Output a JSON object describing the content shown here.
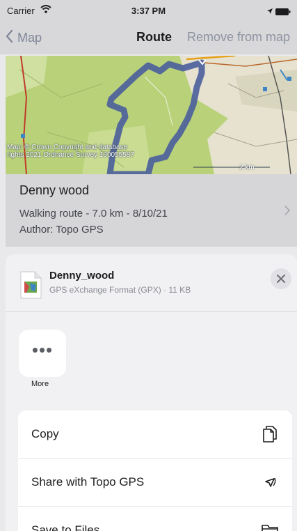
{
  "status_bar": {
    "carrier": "Carrier",
    "time": "3:37 PM"
  },
  "nav": {
    "back_label": "Map",
    "title": "Route",
    "action_label": "Remove from map"
  },
  "map": {
    "attribution": "Map: © Crown Copyright and database rights 2021 Ordnance Survey 100055587",
    "scale_label": "2 km"
  },
  "route": {
    "name": "Denny wood",
    "details": "Walking route - 7.0 km - 8/10/21",
    "author": "Author: Topo GPS"
  },
  "share_sheet": {
    "file_name": "Denny_wood",
    "file_meta": "GPS eXchange Format (GPX) · 11 KB",
    "more_label": "More",
    "actions": [
      {
        "label": "Copy",
        "icon": "copy-icon"
      },
      {
        "label": "Share with Topo GPS",
        "icon": "topo-gps-icon"
      },
      {
        "label": "Save to Files",
        "icon": "folder-icon"
      }
    ]
  },
  "colors": {
    "route_line": "#4a5e9c",
    "map_green": "#b9d27a",
    "sheet_bg": "#f1f1f4",
    "dim_bg": "#d8d8db"
  }
}
